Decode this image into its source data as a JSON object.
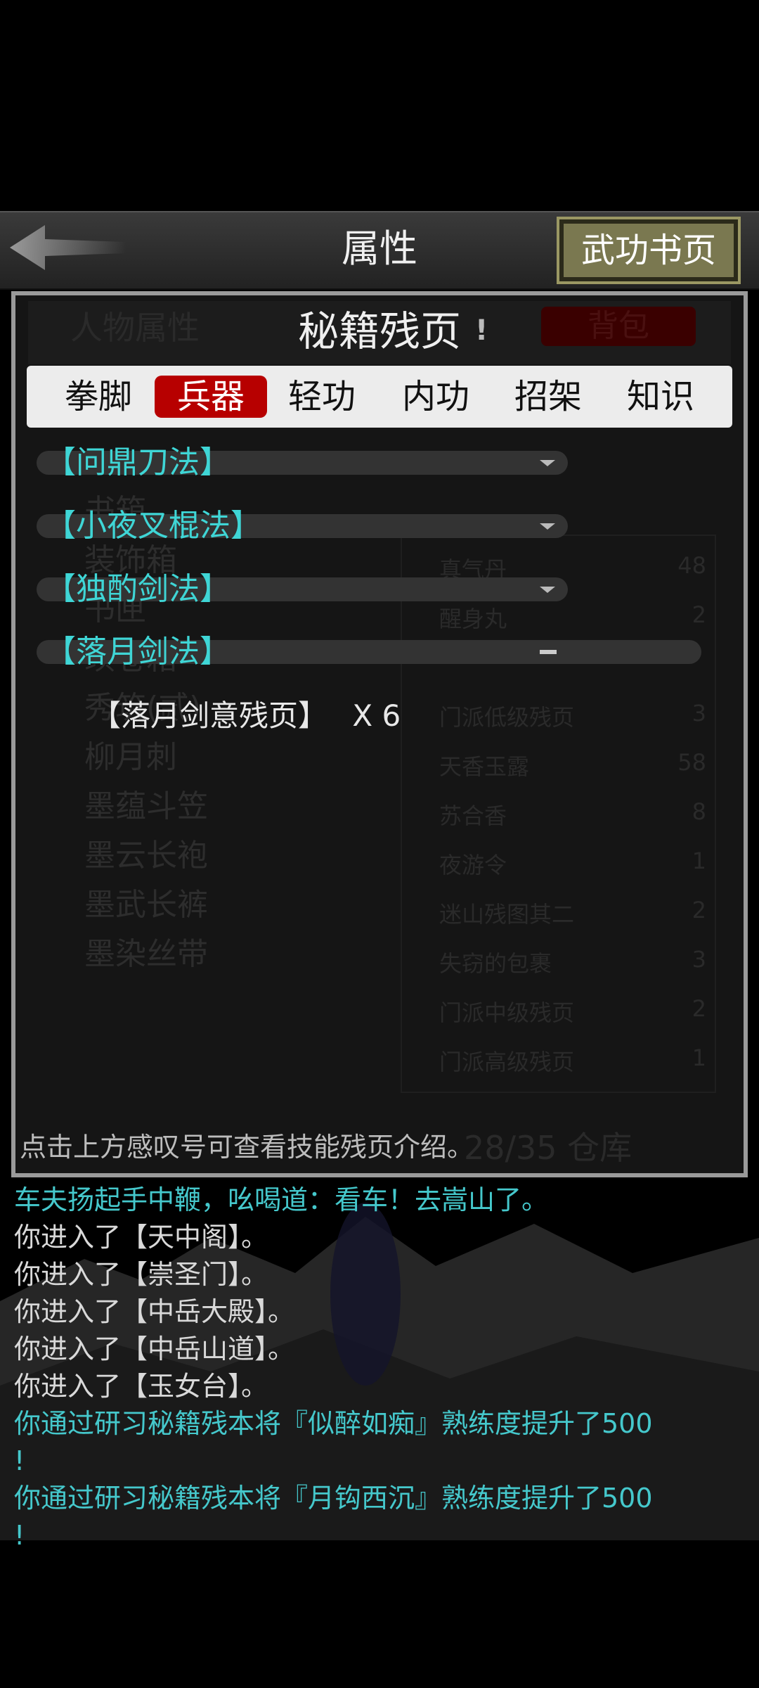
{
  "header": {
    "title": "属性",
    "skill_page_label": "武功书页"
  },
  "panel": {
    "subtitle": "秘籍残页",
    "info_mark": "!",
    "bg_tab_left": "人物属性",
    "bag_label": "背包",
    "tabs": [
      {
        "label": "拳脚",
        "active": false
      },
      {
        "label": "兵器",
        "active": true
      },
      {
        "label": "轻功",
        "active": false
      },
      {
        "label": "内功",
        "active": false
      },
      {
        "label": "招架",
        "active": false
      },
      {
        "label": "知识",
        "active": false
      }
    ],
    "categories": [
      {
        "label": "【问鼎刀法】",
        "expanded": false
      },
      {
        "label": "【小夜叉棍法】",
        "expanded": false
      },
      {
        "label": "【独酌剑法】",
        "expanded": false
      },
      {
        "label": "【落月剑法】",
        "expanded": true
      }
    ],
    "item": {
      "name": "【落月剑意残页】",
      "count": "X 6"
    },
    "hint": "点击上方感叹号可查看技能残页介绍。",
    "background_items_left": [
      "书箱",
      "装饰箱",
      "书匣",
      "续卷箱",
      "秀筑(贰)",
      "柳月刺",
      "墨蕴斗笠",
      "墨云长袍",
      "墨武长裤",
      "墨染丝带"
    ],
    "background_items_right": [
      {
        "name": "真气丹",
        "qty": "48"
      },
      {
        "name": "醒身丸",
        "qty": "2"
      },
      {
        "name": "门派低级残页",
        "qty": "3"
      },
      {
        "name": "天香玉露",
        "qty": "58"
      },
      {
        "name": "苏合香",
        "qty": "8"
      },
      {
        "name": "夜游令",
        "qty": "1"
      },
      {
        "name": "迷山残图其二",
        "qty": "2"
      },
      {
        "name": "失窃的包裹",
        "qty": "3"
      },
      {
        "name": "门派中级残页",
        "qty": "2"
      },
      {
        "name": "门派高级残页",
        "qty": "1"
      }
    ],
    "background_count": "28/35 仓库"
  },
  "log": [
    {
      "text": "车夫扬起手中鞭，吆喝道：看车！去嵩山了。",
      "color": "cyan"
    },
    {
      "text": "你进入了【天中阁】。",
      "color": "white"
    },
    {
      "text": "你进入了【崇圣门】。",
      "color": "white"
    },
    {
      "text": "你进入了【中岳大殿】。",
      "color": "white"
    },
    {
      "text": "你进入了【中岳山道】。",
      "color": "white"
    },
    {
      "text": "你进入了【玉女台】。",
      "color": "white"
    },
    {
      "text": "你通过研习秘籍残本将『似醉如痴』熟练度提升了500",
      "color": "cyan"
    },
    {
      "text": "!",
      "color": "cyan"
    },
    {
      "text": "你通过研习秘籍残本将『月钩西沉』熟练度提升了500",
      "color": "cyan"
    },
    {
      "text": "!",
      "color": "cyan"
    }
  ],
  "icons": {
    "back": "back-arrow-icon",
    "collapsed": "chevron-down-icon",
    "expanded": "minus-icon"
  },
  "colors": {
    "accent_red": "#b70000",
    "skill_cyan": "#3fd6d6",
    "button_olive": "#7a7850"
  }
}
